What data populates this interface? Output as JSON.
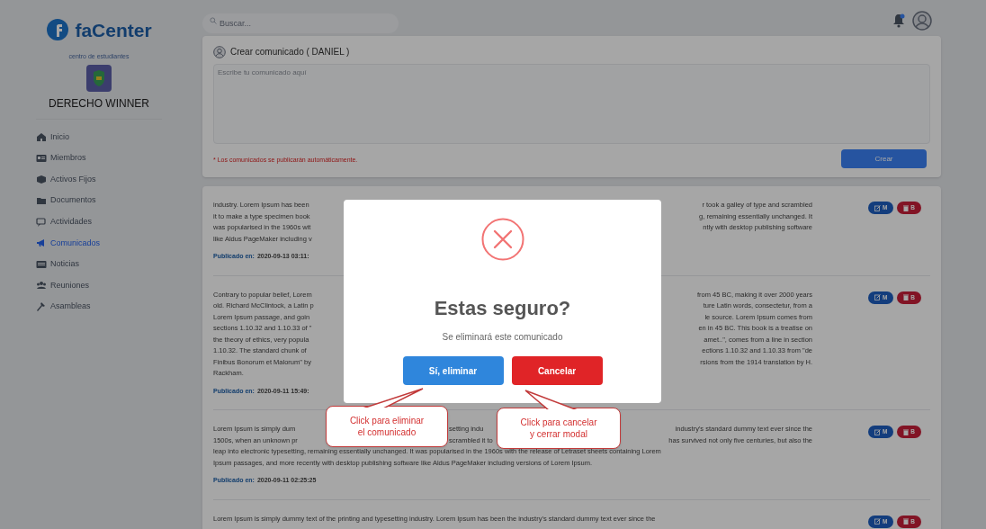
{
  "sidebar": {
    "logo_text": "faCenter",
    "org_caption": "centro de estudiantes",
    "org_name": "DERECHO WINNER",
    "items": [
      {
        "label": "Inicio",
        "selected": false
      },
      {
        "label": "Miembros",
        "selected": false
      },
      {
        "label": "Activos Fijos",
        "selected": false
      },
      {
        "label": "Documentos",
        "selected": false
      },
      {
        "label": "Actividades",
        "selected": false
      },
      {
        "label": "Comunicados",
        "selected": true
      },
      {
        "label": "Noticias",
        "selected": false
      },
      {
        "label": "Reuniones",
        "selected": false
      },
      {
        "label": "Asambleas",
        "selected": false
      }
    ]
  },
  "search": {
    "placeholder": "Buscar..."
  },
  "compose": {
    "title": "Crear comunicado ( DANIEL )",
    "placeholder": "Escribe tu comunicado aquí",
    "note": "* Los comunicados se publicarán automáticamente.",
    "button": "Crear"
  },
  "posts": [
    {
      "lines": [
        [
          "industry. Lorem Ipsum has been",
          "r took a galley of type and scrambled"
        ],
        [
          "it to make a type specimen book",
          "g, remaining essentially unchanged. It"
        ],
        [
          "was popularised in the 1960s wit",
          "ntly with desktop publishing software"
        ],
        [
          "like Aldus PageMaker including v"
        ]
      ],
      "published_label": "Publicado en:",
      "published_at": "2020-09-13 03:11:",
      "edit_label": "M",
      "delete_label": "B"
    },
    {
      "lines": [
        [
          "Contrary to popular belief, Lorem",
          "from 45 BC, making it over 2000 years"
        ],
        [
          "old. Richard McClintock, a Latin p",
          "ture Latin words, consectetur, from a"
        ],
        [
          "Lorem Ipsum passage, and goin",
          "le source. Lorem Ipsum comes from"
        ],
        [
          "sections 1.10.32 and 1.10.33 of \"",
          "en in 45 BC. This book is a treatise on"
        ],
        [
          "the theory of ethics, very popula",
          "amet..\", comes from a line in section"
        ],
        [
          "1.10.32. The standard chunk of",
          "ections 1.10.32 and 1.10.33 from \"de"
        ],
        [
          "Finibus Bonorum et Malorum\" by",
          "rsions from the 1914 translation by H."
        ],
        [
          "Rackham."
        ]
      ],
      "published_label": "Publicado en:",
      "published_at": "2020-09-11 15:49:",
      "edit_label": "M",
      "delete_label": "B"
    },
    {
      "lines": [
        [
          "Lorem Ipsum is simply dum",
          "setting indu",
          "industry's standard dummy text ever since the"
        ],
        [
          "1500s, when an unknown pr",
          "scrambled it to",
          "has survived not only five centuries, but also the"
        ],
        [
          "leap into electronic typesetting, remaining essentially unchanged. It was popularised in the 1960s with the release of Letraset sheets containing Lorem"
        ],
        [
          "Ipsum passages, and more recently with desktop publishing software like Aldus PageMaker including versions of Lorem Ipsum."
        ]
      ],
      "published_label": "Publicado en:",
      "published_at": "2020-09-11 02:25:25",
      "edit_label": "M",
      "delete_label": "B"
    },
    {
      "lines": [
        [
          "Lorem Ipsum is simply dummy text of the printing and typesetting industry. Lorem Ipsum has been the industry's standard dummy text ever since the"
        ]
      ],
      "edit_label": "M",
      "delete_label": "B"
    }
  ],
  "modal": {
    "title": "Estas seguro?",
    "message": "Se eliminará este comunicado",
    "confirm": "Sí, eliminar",
    "cancel": "Cancelar"
  },
  "callouts": [
    {
      "text": "Click para eliminar\nel comunicado"
    },
    {
      "text": "Click para cancelar\ny cerrar modal"
    }
  ]
}
